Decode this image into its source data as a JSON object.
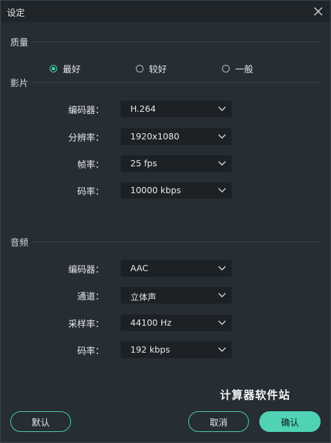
{
  "window": {
    "title": "设定"
  },
  "sections": {
    "quality": "质量",
    "video": "影片",
    "audio": "音频"
  },
  "quality_options": [
    {
      "label": "最好",
      "selected": true
    },
    {
      "label": "较好",
      "selected": false
    },
    {
      "label": "一般",
      "selected": false
    }
  ],
  "video_settings": [
    {
      "label": "编码器：",
      "value": "H.264"
    },
    {
      "label": "分辨率：",
      "value": "1920x1080"
    },
    {
      "label": "帧率：",
      "value": "25 fps"
    },
    {
      "label": "码率：",
      "value": "10000 kbps"
    }
  ],
  "audio_settings": [
    {
      "label": "编码器：",
      "value": "AAC"
    },
    {
      "label": "通道：",
      "value": "立体声"
    },
    {
      "label": "采样率：",
      "value": "44100 Hz"
    },
    {
      "label": "码率：",
      "value": "192 kbps"
    }
  ],
  "watermark": "计算器软件站",
  "buttons": {
    "default": "默认",
    "cancel": "取消",
    "confirm": "确认"
  },
  "colors": {
    "accent": "#4fd3b4",
    "background": "#262d33",
    "field": "#1c2125"
  },
  "icons": {
    "close": "close-icon",
    "dropdown": "chevron-down-icon",
    "radio": "radio-icon"
  }
}
